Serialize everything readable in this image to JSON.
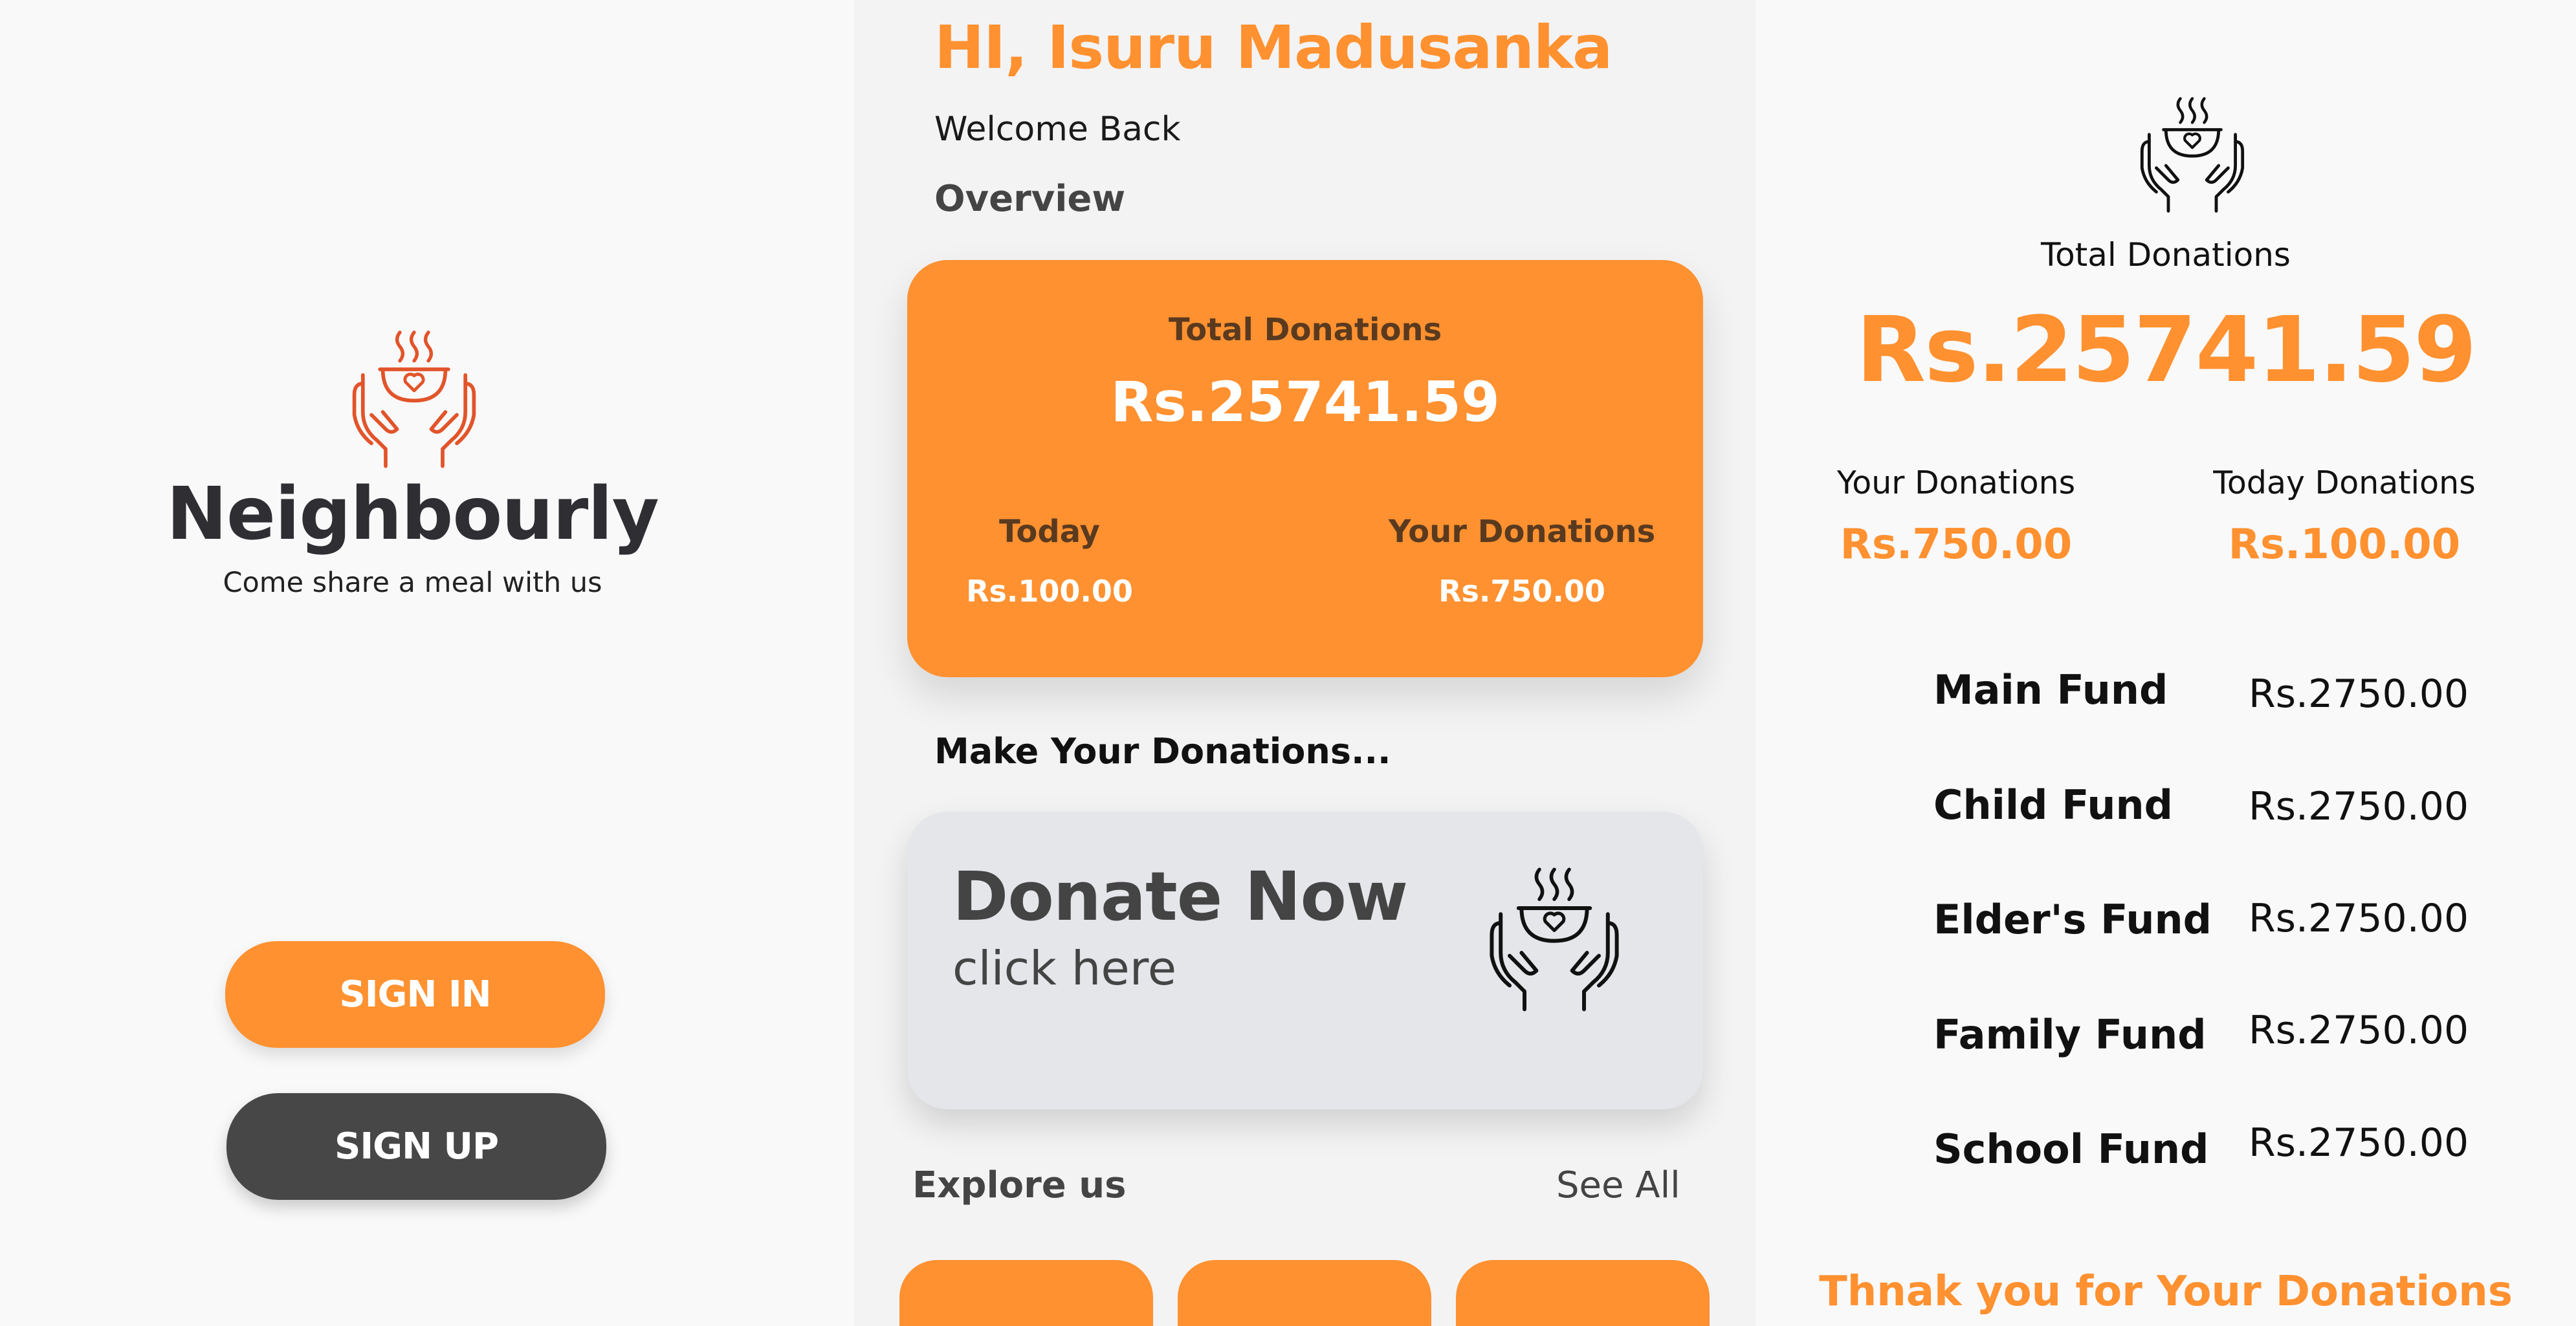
{
  "colors": {
    "accent": "#ff9130",
    "dark_button": "#474747",
    "card_grey": "#e4e6ea",
    "logo_line": "#e2542a"
  },
  "landing": {
    "logo_icon": "bowl-heart-hands-icon",
    "app_name": "Neighbourly",
    "tagline": "Come share a meal with us",
    "sign_in_label": "SIGN IN",
    "sign_up_label": "SIGN UP"
  },
  "home": {
    "greeting": "HI, Isuru Madusanka",
    "welcome": "Welcome Back",
    "overview_heading": "Overview",
    "card": {
      "total_label": "Total Donations",
      "total_value": "Rs.25741.59",
      "today_label": "Today",
      "today_value": "Rs.100.00",
      "your_label": "Your Donations",
      "your_value": "Rs.750.00"
    },
    "make_heading": "Make Your Donations...",
    "donate": {
      "title": "Donate Now",
      "subtitle": "click here",
      "icon": "bowl-heart-hands-icon"
    },
    "explore_heading": "Explore us",
    "see_all_label": "See All"
  },
  "details": {
    "logo_icon": "bowl-heart-hands-icon",
    "total_label": "Total Donations",
    "total_value": "Rs.25741.59",
    "your_label": "Your Donations",
    "your_value": "Rs.750.00",
    "today_label": "Today Donations",
    "today_value": "Rs.100.00",
    "funds": [
      {
        "name": "Main Fund",
        "amount": "Rs.2750.00"
      },
      {
        "name": "Child Fund",
        "amount": "Rs.2750.00"
      },
      {
        "name": "Elder's Fund",
        "amount": "Rs.2750.00"
      },
      {
        "name": "Family Fund",
        "amount": "Rs.2750.00"
      },
      {
        "name": "School Fund",
        "amount": "Rs.2750.00"
      }
    ],
    "thanks": "Thnak you for Your Donations"
  }
}
